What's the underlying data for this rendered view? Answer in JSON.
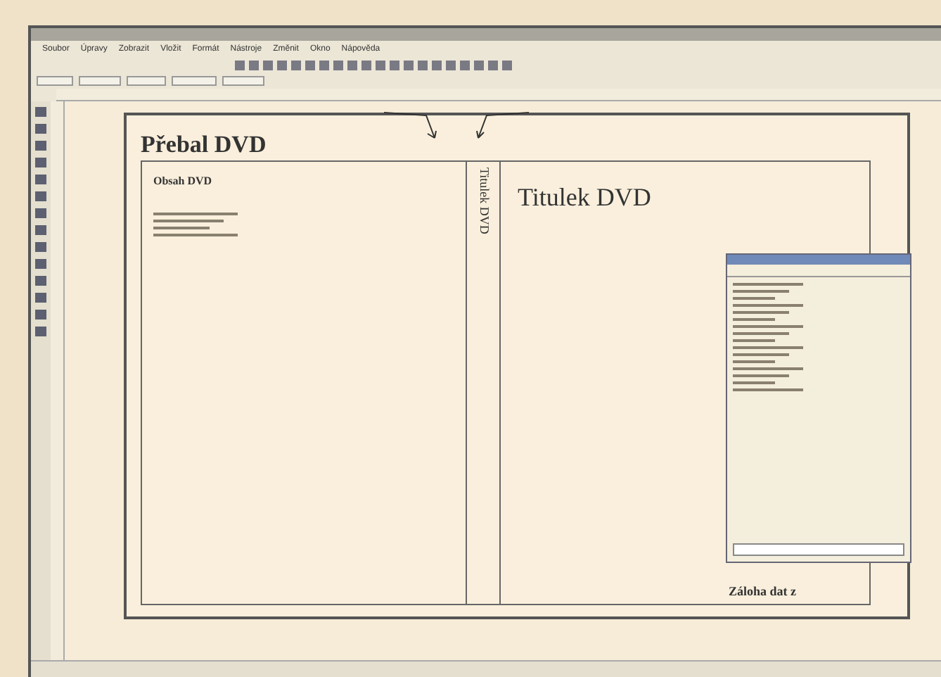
{
  "menu": [
    "Soubor",
    "Úpravy",
    "Zobrazit",
    "Vložit",
    "Formát",
    "Nástroje",
    "Změnit",
    "Okno",
    "Nápověda"
  ],
  "document": {
    "title": "Přebal DVD",
    "back_heading": "Obsah DVD",
    "spine_text": "Titulek DVD",
    "front_title": "Titulek DVD",
    "footer_text": "Záloha dat z"
  }
}
